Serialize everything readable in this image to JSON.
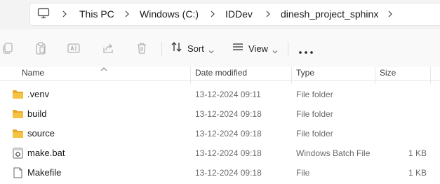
{
  "breadcrumb": {
    "items": [
      "This PC",
      "Windows (C:)",
      "IDDev",
      "dinesh_project_sphinx"
    ]
  },
  "toolbar": {
    "sort_label": "Sort",
    "view_label": "View",
    "icons": [
      "copy-icon",
      "paste-icon",
      "rename-icon",
      "share-icon",
      "delete-icon",
      "sort-icon",
      "view-icon",
      "more-icon"
    ]
  },
  "columns": {
    "name": "Name",
    "date_modified": "Date modified",
    "type": "Type",
    "size": "Size"
  },
  "files": [
    {
      "name": ".venv",
      "date": "13-12-2024 09:11",
      "type": "File folder",
      "size": "",
      "icon": "folder-icon"
    },
    {
      "name": "build",
      "date": "13-12-2024 09:18",
      "type": "File folder",
      "size": "",
      "icon": "folder-icon"
    },
    {
      "name": "source",
      "date": "13-12-2024 09:18",
      "type": "File folder",
      "size": "",
      "icon": "folder-icon"
    },
    {
      "name": "make.bat",
      "date": "13-12-2024 09:18",
      "type": "Windows Batch File",
      "size": "1 KB",
      "icon": "batch-file-icon"
    },
    {
      "name": "Makefile",
      "date": "13-12-2024 09:18",
      "type": "File",
      "size": "1 KB",
      "icon": "file-icon"
    }
  ],
  "colors": {
    "folder": "#f4c343",
    "folder_back": "#e8a92b",
    "addressbar_bg": "#f3f3f3",
    "toolbar_bg": "#f9f9f9",
    "disabled_icon": "#b4b4b4",
    "secondary_text": "#6a6a6a"
  }
}
